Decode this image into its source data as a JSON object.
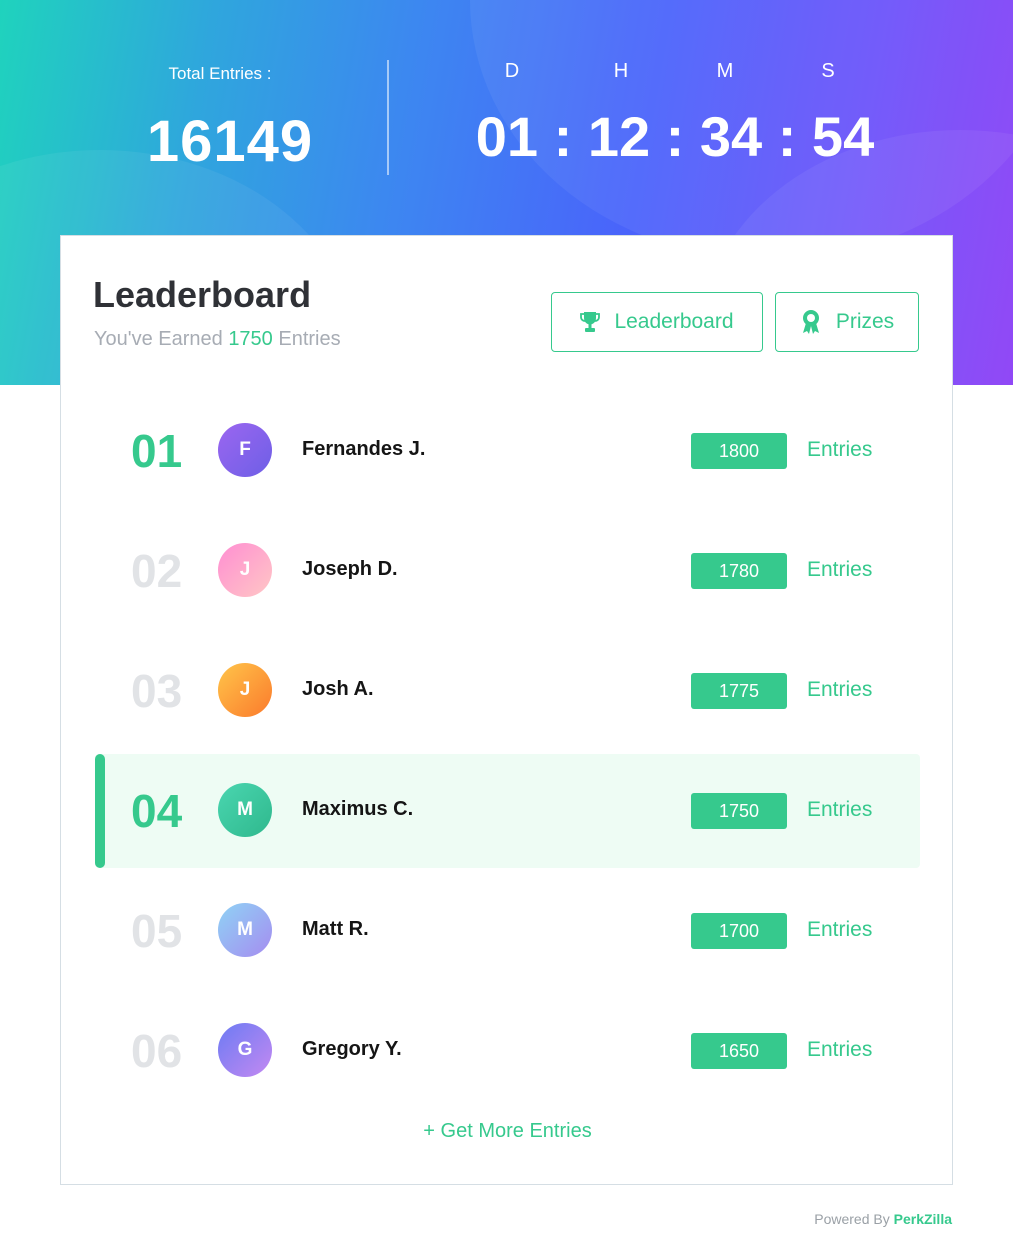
{
  "header": {
    "total_label": "Total Entries :",
    "total_value": "16149",
    "countdown": {
      "labels": [
        "D",
        "H",
        "M",
        "S"
      ],
      "display": "01 : 12 : 34 : 54"
    }
  },
  "card": {
    "title": "Leaderboard",
    "subtitle_prefix": "You've Earned",
    "subtitle_value": "1750",
    "subtitle_suffix": "Entries",
    "tabs": {
      "leaderboard": {
        "label": "Leaderboard",
        "icon": "trophy-icon"
      },
      "prizes": {
        "label": "Prizes",
        "icon": "award-ribbon-icon"
      }
    },
    "rows": [
      {
        "rank": "01",
        "initial": "F",
        "name": "Fernandes J.",
        "score": "1800",
        "unit": "Entries"
      },
      {
        "rank": "02",
        "initial": "J",
        "name": "Joseph D.",
        "score": "1780",
        "unit": "Entries"
      },
      {
        "rank": "03",
        "initial": "J",
        "name": "Josh A.",
        "score": "1775",
        "unit": "Entries"
      },
      {
        "rank": "04",
        "initial": "M",
        "name": "Maximus C.",
        "score": "1750",
        "unit": "Entries"
      },
      {
        "rank": "05",
        "initial": "M",
        "name": "Matt R.",
        "score": "1700",
        "unit": "Entries"
      },
      {
        "rank": "06",
        "initial": "G",
        "name": "Gregory Y.",
        "score": "1650",
        "unit": "Entries"
      }
    ],
    "more_label": "+ Get More Entries"
  },
  "footer": {
    "powered_prefix": "Powered By",
    "brand": "PerkZilla"
  },
  "colors": {
    "accent": "#36c98d",
    "highlight_row": "#eefcf4",
    "gradient_start": "#1fd3bd",
    "gradient_end": "#8b3df6"
  }
}
